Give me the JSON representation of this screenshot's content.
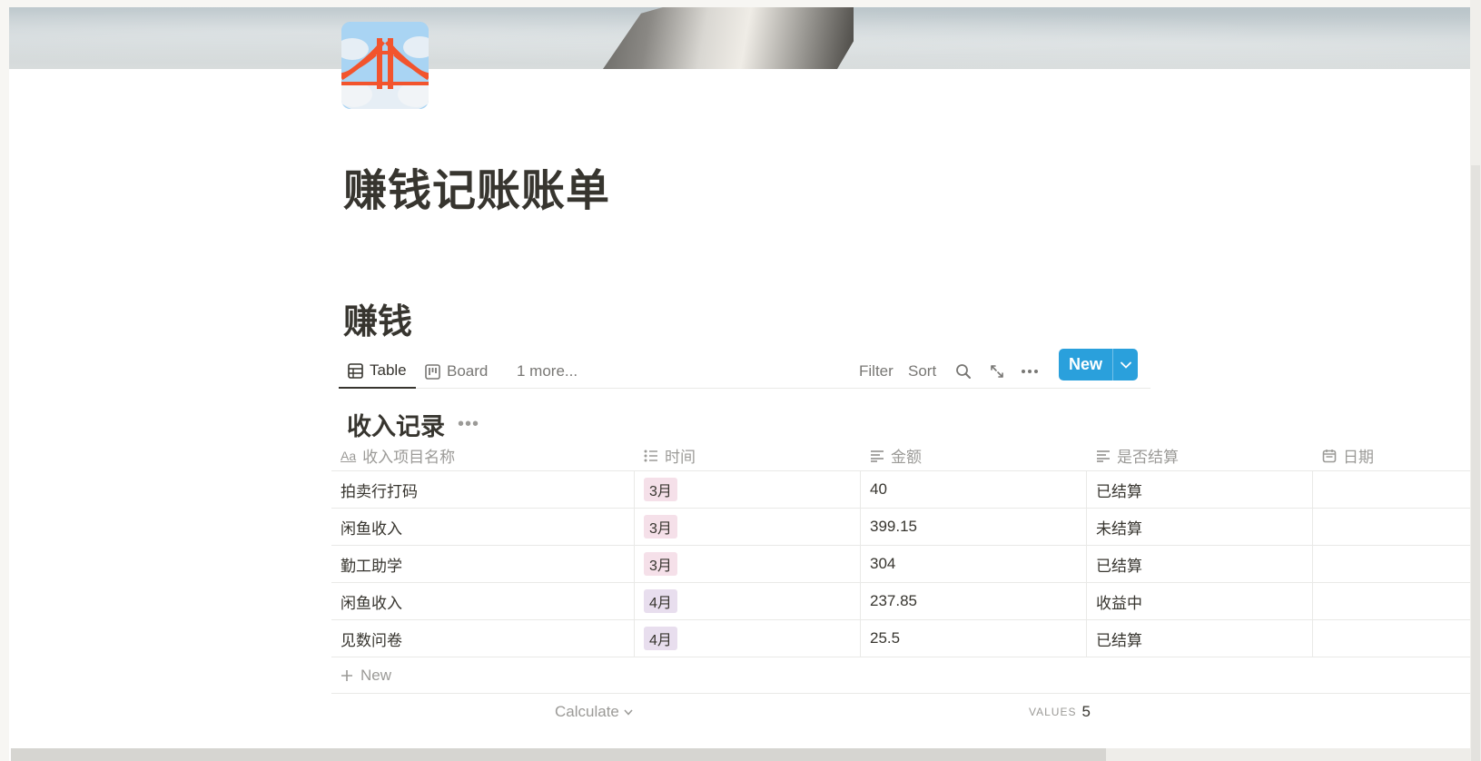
{
  "page": {
    "title": "赚钱记账账单",
    "section_heading": "赚钱"
  },
  "views": {
    "tabs": [
      {
        "label": "Table",
        "icon": "table-icon",
        "active": true
      },
      {
        "label": "Board",
        "icon": "board-icon",
        "active": false
      },
      {
        "label": "1 more...",
        "icon": "",
        "active": false
      }
    ],
    "toolbar": {
      "filter_label": "Filter",
      "sort_label": "Sort",
      "new_label": "New"
    }
  },
  "database": {
    "title": "收入记录",
    "columns": [
      {
        "label": "收入项目名称",
        "icon": "text-type-icon"
      },
      {
        "label": "时间",
        "icon": "multi-select-icon"
      },
      {
        "label": "金额",
        "icon": "text-lines-icon"
      },
      {
        "label": "是否结算",
        "icon": "text-lines-icon"
      },
      {
        "label": "日期",
        "icon": "calendar-icon"
      }
    ],
    "rows": [
      {
        "name": "拍卖行打码",
        "time": "3月",
        "amount": "40",
        "settled": "已结算",
        "date": ""
      },
      {
        "name": "闲鱼收入",
        "time": "3月",
        "amount": "399.15",
        "settled": "未结算",
        "date": ""
      },
      {
        "name": "勤工助学",
        "time": "3月",
        "amount": "304",
        "settled": "已结算",
        "date": ""
      },
      {
        "name": "闲鱼收入",
        "time": "4月",
        "amount": "237.85",
        "settled": "收益中",
        "date": ""
      },
      {
        "name": "见数问卷",
        "time": "4月",
        "amount": "25.5",
        "settled": "已结算",
        "date": ""
      }
    ],
    "new_row_label": "New",
    "footer": {
      "calculate_label": "Calculate",
      "values_label": "VALUES",
      "values_count": "5"
    }
  },
  "colors": {
    "accent_button": "#2aa0dc",
    "tag_march": "#f5e0e9",
    "tag_april": "#e8deee"
  }
}
